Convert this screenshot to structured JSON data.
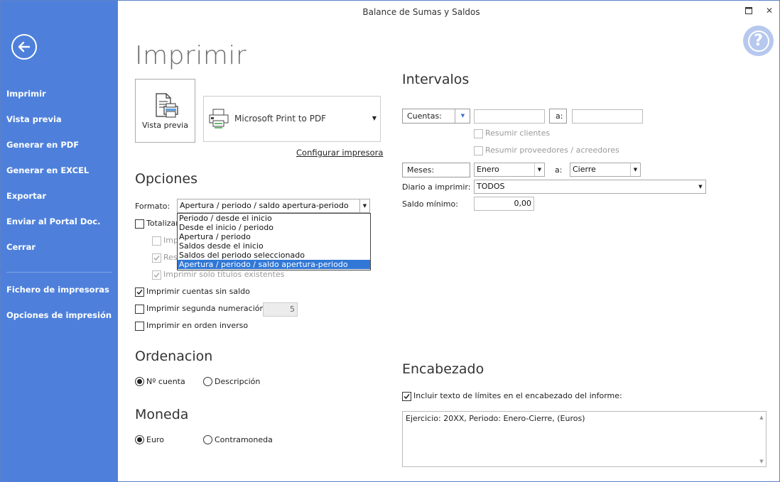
{
  "window": {
    "title": "Balance de Sumas y Saldos",
    "maximize_glyph": "□",
    "close_glyph": "✕",
    "help_glyph": "?"
  },
  "sidebar": {
    "items": [
      {
        "label": "Imprimir"
      },
      {
        "label": "Vista previa"
      },
      {
        "label": "Generar en PDF"
      },
      {
        "label": "Generar en EXCEL"
      },
      {
        "label": "Exportar"
      },
      {
        "label": "Enviar al Portal Doc."
      },
      {
        "label": "Cerrar"
      },
      {
        "label": "Fichero de impresoras"
      },
      {
        "label": "Opciones de impresión"
      }
    ]
  },
  "page": {
    "title": "Imprimir",
    "preview_label": "Vista previa",
    "printer_name": "Microsoft Print to PDF",
    "configure_printer": "Configurar impresora"
  },
  "options": {
    "title": "Opciones",
    "format_label": "Formato:",
    "format_value": "Apertura / periodo / saldo apertura-periodo",
    "format_options": [
      "Periodo / desde el inicio",
      "Desde el inicio / periodo",
      "Apertura / periodo",
      "Saldos desde el inicio",
      "Saldos del periodo seleccionado",
      "Apertura / periodo / saldo apertura-periodo"
    ],
    "totalizar_label": "Totalizar",
    "impr_label": "Imp",
    "res_label": "Res",
    "imprimir_titulos": "Imprimir solo títulos existentes",
    "cuentas_sin_saldo": "Imprimir cuentas sin saldo",
    "segunda_numeracion": "Imprimir segunda numeración",
    "segunda_numeracion_value": "5",
    "orden_inverso": "Imprimir en orden inverso"
  },
  "ordenacion": {
    "title": "Ordenacion",
    "cuenta": "Nº cuenta",
    "descripcion": "Descripción"
  },
  "moneda": {
    "title": "Moneda",
    "euro": "Euro",
    "contramoneda": "Contramoneda"
  },
  "intervalos": {
    "title": "Intervalos",
    "cuentas_label": "Cuentas:",
    "a_label": "a:",
    "resumir_clientes": "Resumir clientes",
    "resumir_proveedores": "Resumir proveedores / acreedores",
    "meses_label": "Meses:",
    "mes_desde": "Enero",
    "mes_a_label": "a:",
    "mes_hasta": "Cierre",
    "diario_label": "Diario a imprimir:",
    "diario_value": "TODOS",
    "saldo_label": "Saldo mínimo:",
    "saldo_value": "0,00"
  },
  "encabezado": {
    "title": "Encabezado",
    "incluir_label": "Incluir texto de límites en el encabezado del informe:",
    "text": "Ejercicio: 20XX, Periodo: Enero-Cierre, (Euros)"
  }
}
